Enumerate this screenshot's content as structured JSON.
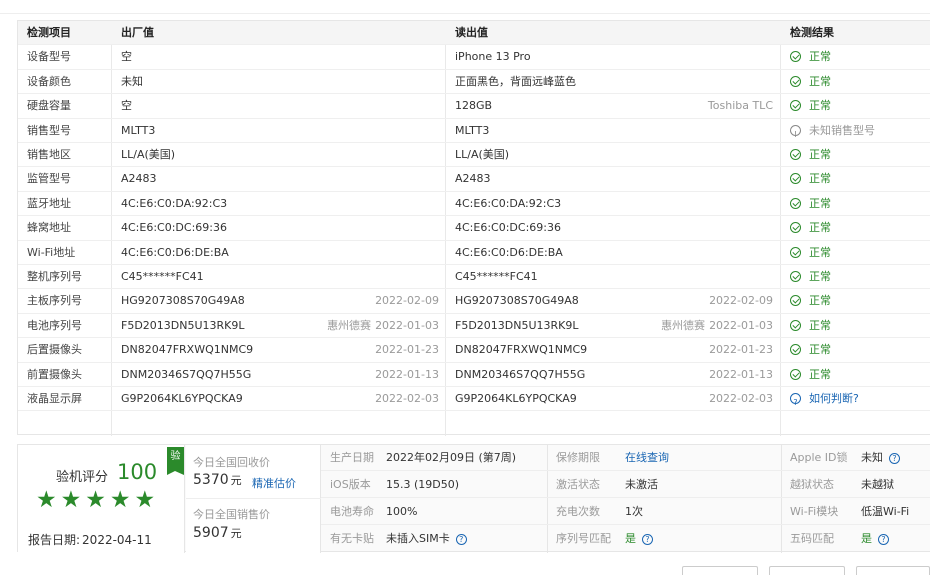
{
  "header": {
    "item": "检测项目",
    "factory": "出厂值",
    "read": "读出值",
    "result": "检测结果"
  },
  "rows": [
    {
      "item": "设备型号",
      "factory": "空",
      "read": "iPhone 13 Pro",
      "result": "正常",
      "status": "ok"
    },
    {
      "item": "设备颜色",
      "factory": "未知",
      "read": "正面黑色，背面远峰蓝色",
      "result": "正常",
      "status": "ok"
    },
    {
      "item": "硬盘容量",
      "factory": "空",
      "read": "128GB",
      "read_note": "Toshiba TLC",
      "result": "正常",
      "status": "ok"
    },
    {
      "item": "销售型号",
      "factory": "MLTT3",
      "read": "MLTT3",
      "result": "未知销售型号",
      "status": "warn"
    },
    {
      "item": "销售地区",
      "factory": "LL/A(美国)",
      "read": "LL/A(美国)",
      "result": "正常",
      "status": "ok"
    },
    {
      "item": "监管型号",
      "factory": "A2483",
      "read": "A2483",
      "result": "正常",
      "status": "ok"
    },
    {
      "item": "蓝牙地址",
      "factory": "4C:E6:C0:DA:92:C3",
      "read": "4C:E6:C0:DA:92:C3",
      "result": "正常",
      "status": "ok"
    },
    {
      "item": "蜂窝地址",
      "factory": "4C:E6:C0:DC:69:36",
      "read": "4C:E6:C0:DC:69:36",
      "result": "正常",
      "status": "ok"
    },
    {
      "item": "Wi-Fi地址",
      "factory": "4C:E6:C0:D6:DE:BA",
      "read": "4C:E6:C0:D6:DE:BA",
      "result": "正常",
      "status": "ok"
    },
    {
      "item": "整机序列号",
      "factory": "C45******FC41",
      "read": "C45******FC41",
      "result": "正常",
      "status": "ok"
    },
    {
      "item": "主板序列号",
      "factory": "HG9207308S70G49A8",
      "factory_date": "2022-02-09",
      "read": "HG9207308S70G49A8",
      "read_date": "2022-02-09",
      "result": "正常",
      "status": "ok"
    },
    {
      "item": "电池序列号",
      "factory": "F5D2013DN5U13RK9L",
      "factory_loc": "惠州德赛",
      "factory_date": "2022-01-03",
      "read": "F5D2013DN5U13RK9L",
      "read_loc": "惠州德赛",
      "read_date": "2022-01-03",
      "result": "正常",
      "status": "ok"
    },
    {
      "item": "后置摄像头",
      "factory": "DN82047FRXWQ1NMC9",
      "factory_date": "2022-01-23",
      "read": "DN82047FRXWQ1NMC9",
      "read_date": "2022-01-23",
      "result": "正常",
      "status": "ok"
    },
    {
      "item": "前置摄像头",
      "factory": "DNM20346S7QQ7H55G",
      "factory_date": "2022-01-13",
      "read": "DNM20346S7QQ7H55G",
      "read_date": "2022-01-13",
      "result": "正常",
      "status": "ok"
    },
    {
      "item": "液晶显示屏",
      "factory": "G9P2064KL6YPQCKA9",
      "factory_date": "2022-02-03",
      "read": "G9P2064KL6YPQCKA9",
      "read_date": "2022-02-03",
      "result": "如何判断?",
      "status": "info"
    }
  ],
  "summary": {
    "score_label": "验机评分",
    "score": "100",
    "badge": "验",
    "stars": "★★★★★",
    "star_rating": 5,
    "report_date_label": "报告日期:",
    "report_date": "2022-04-11",
    "recycle_label": "今日全国回收价",
    "recycle_price": "5370",
    "currency": "元",
    "estimate_link": "精准估价",
    "sale_label": "今日全国销售价",
    "sale_price": "5907",
    "info": [
      [
        {
          "label": "生产日期",
          "value": "2022年02月09日 (第7周)"
        },
        {
          "label": "保修期限",
          "link": "在线查询"
        },
        {
          "label": "Apple ID锁",
          "value": "未知",
          "help": "?"
        }
      ],
      [
        {
          "label": "iOS版本",
          "value": "15.3 (19D50)"
        },
        {
          "label": "激活状态",
          "value": "未激活"
        },
        {
          "label": "越狱状态",
          "value": "未越狱"
        }
      ],
      [
        {
          "label": "电池寿命",
          "value": "100%"
        },
        {
          "label": "充电次数",
          "value": "1次"
        },
        {
          "label": "Wi-Fi模块",
          "value": "低温Wi-Fi"
        }
      ],
      [
        {
          "label": "有无卡贴",
          "value": "未插入SIM卡",
          "help": "?"
        },
        {
          "label": "序列号匹配",
          "value": "是",
          "help": "?"
        },
        {
          "label": "五码匹配",
          "value": "是",
          "help": "?"
        }
      ]
    ]
  }
}
